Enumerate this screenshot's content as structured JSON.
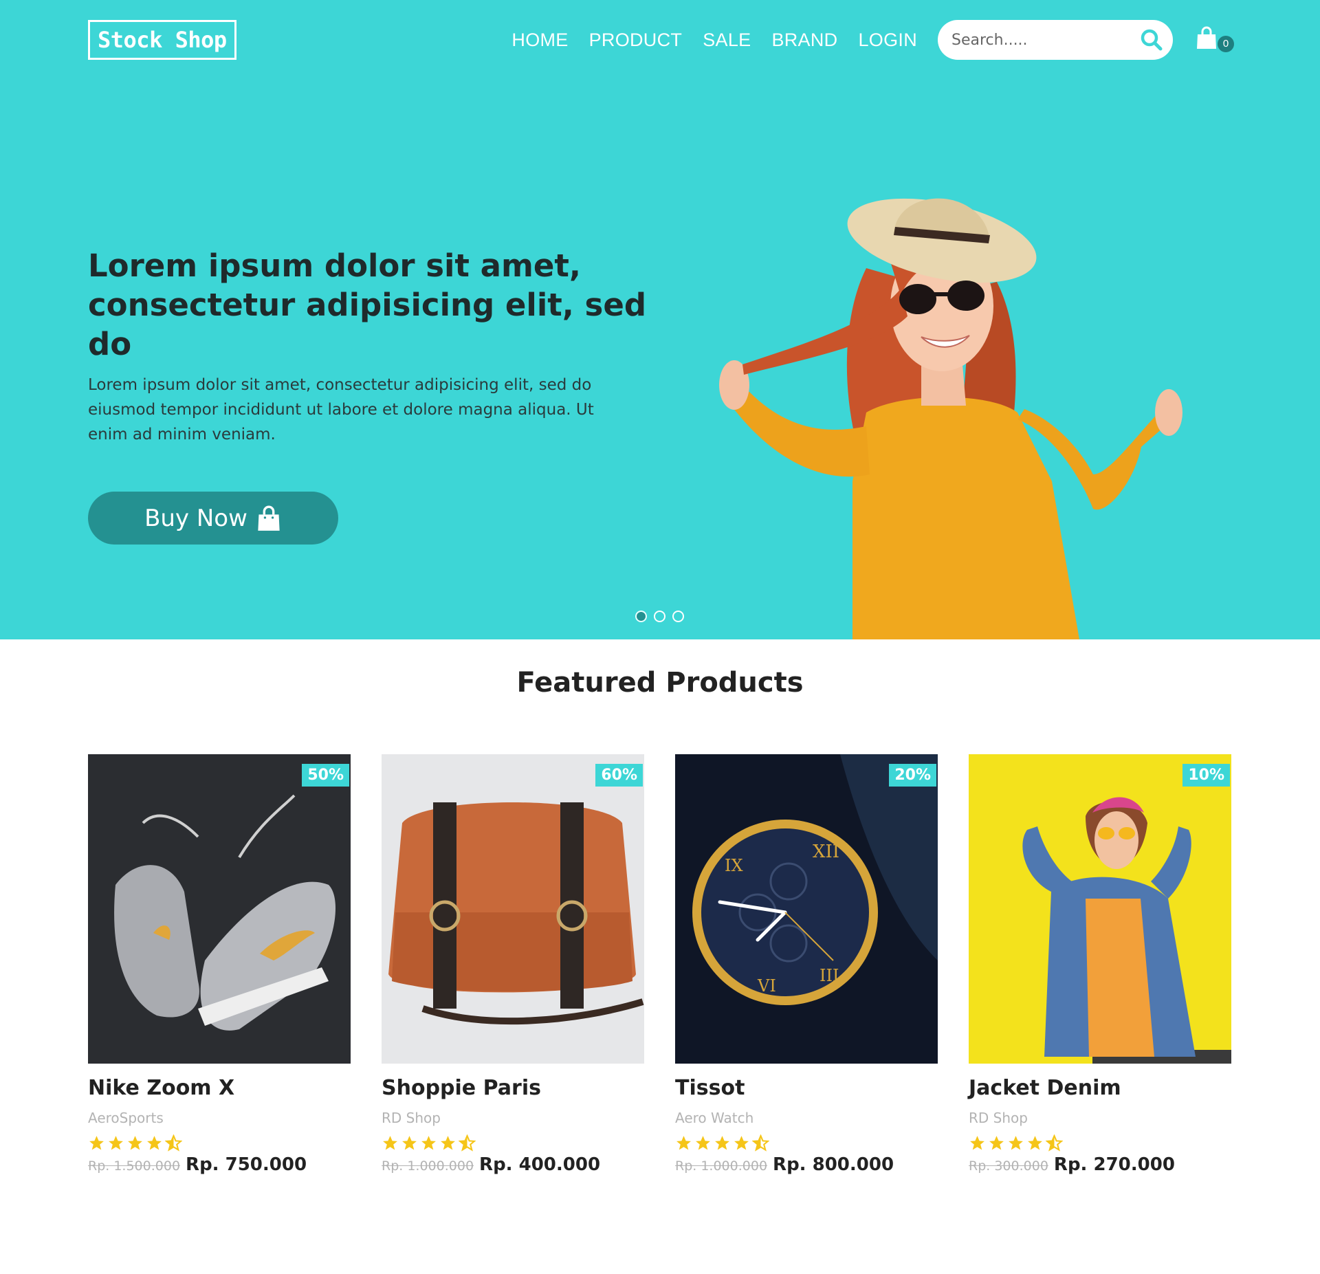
{
  "colors": {
    "primary": "#3dd6d6",
    "button": "#249191",
    "star": "#f5c518"
  },
  "nav": {
    "logo": "Stock Shop",
    "menu": [
      "HOME",
      "PRODUCT",
      "SALE",
      "BRAND",
      "LOGIN"
    ],
    "search_placeholder": "Search.....",
    "cart_count": "0"
  },
  "hero": {
    "title": "Lorem ipsum dolor sit amet, consectetur adipisicing elit, sed do",
    "text": "Lorem ipsum dolor sit amet, consectetur adipisicing elit, sed do eiusmod tempor incididunt ut labore et dolore magna aliqua. Ut enim ad minim veniam.",
    "button_label": "Buy Now",
    "slides": 3,
    "active_slide": 1
  },
  "featured": {
    "title": "Featured Products",
    "products": [
      {
        "name": "Nike Zoom X",
        "brand": "AeroSports",
        "discount": "50%",
        "rating": 4.5,
        "old_price": "Rp. 1.500.000",
        "price": "Rp. 750.000",
        "image": "sneakers"
      },
      {
        "name": "Shoppie Paris",
        "brand": "RD Shop",
        "discount": "60%",
        "rating": 4.5,
        "old_price": "Rp. 1.000.000",
        "price": "Rp. 400.000",
        "image": "leather-bag"
      },
      {
        "name": "Tissot",
        "brand": "Aero Watch",
        "discount": "20%",
        "rating": 4.5,
        "old_price": "Rp. 1.000.000",
        "price": "Rp. 800.000",
        "image": "watch"
      },
      {
        "name": "Jacket Denim",
        "brand": "RD Shop",
        "discount": "10%",
        "rating": 4.5,
        "old_price": "Rp. 300.000",
        "price": "Rp. 270.000",
        "image": "denim-jacket-woman"
      }
    ]
  }
}
